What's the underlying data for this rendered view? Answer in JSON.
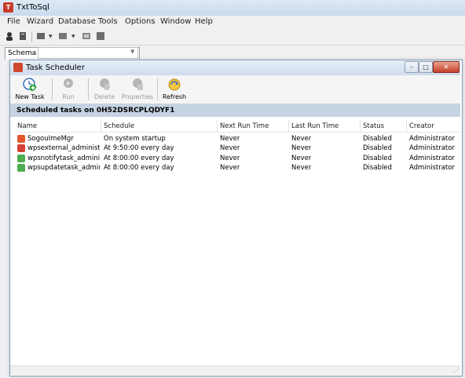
{
  "app": {
    "title": "TxtToSql"
  },
  "menu": [
    "File",
    "Wizard",
    "Database",
    "Tools",
    "Options",
    "Window",
    "Help"
  ],
  "schema": {
    "label": "Schema",
    "value": ""
  },
  "task_window": {
    "title": "Task Scheduler",
    "toolbar": {
      "new_task": "New Task",
      "run": "Run",
      "delete": "Delete",
      "properties": "Properties",
      "refresh": "Refresh"
    },
    "header": "Scheduled tasks on 0H52DSRCPLQDYF1",
    "columns": [
      "Name",
      "Schedule",
      "Next Run Time",
      "Last Run Time",
      "Status",
      "Creator"
    ],
    "rows": [
      {
        "name": "SogouImeMgr",
        "schedule": "On system startup",
        "next_run": "Never",
        "last_run": "Never",
        "status": "Disabled",
        "creator": "Administrator",
        "icon": "sogou-icon",
        "color": "#e2572b"
      },
      {
        "name": "wpsexternal_administr...",
        "schedule": "At 9:50:00 every day",
        "next_run": "Never",
        "last_run": "Never",
        "status": "Disabled",
        "creator": "Administrator",
        "icon": "wps-icon",
        "color": "#d64034"
      },
      {
        "name": "wpsnotifytask_adminis...",
        "schedule": "At 8:00:00 every day",
        "next_run": "Never",
        "last_run": "Never",
        "status": "Disabled",
        "creator": "Administrator",
        "icon": "task-icon",
        "color": "#4caf50"
      },
      {
        "name": "wpsupdatetask_admini...",
        "schedule": "At 8:00:00 every day",
        "next_run": "Never",
        "last_run": "Never",
        "status": "Disabled",
        "creator": "Administrator",
        "icon": "task-icon",
        "color": "#4caf50"
      }
    ]
  }
}
